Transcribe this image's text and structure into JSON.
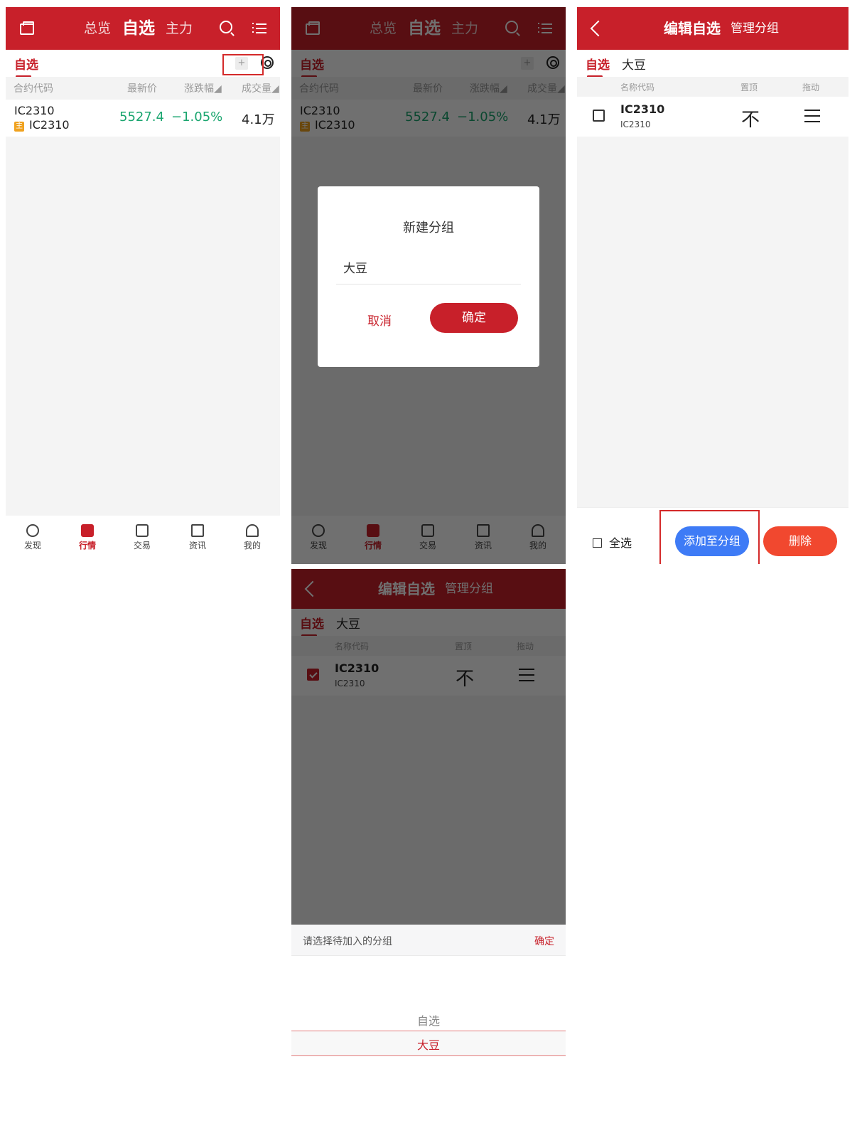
{
  "market": {
    "tabs": [
      "总览",
      "自选",
      "主力"
    ],
    "subtab": "自选",
    "plus": "+",
    "columns": [
      "合约代码",
      "最新价",
      "涨跌幅◢",
      "成交量◢"
    ],
    "row": {
      "code": "IC2310",
      "tag": "主",
      "code2": "IC2310",
      "price": "5527.4",
      "change": "−1.05%",
      "volume": "4.1万"
    },
    "nav": [
      "发现",
      "行情",
      "交易",
      "资讯",
      "我的"
    ]
  },
  "dialog": {
    "title": "新建分组",
    "input_value": "大豆",
    "cancel": "取消",
    "confirm": "确定"
  },
  "edit": {
    "title": "编辑自选",
    "manage": "管理分组",
    "groups": [
      "自选",
      "大豆"
    ],
    "columns": [
      "名称代码",
      "置顶",
      "拖动"
    ],
    "row": {
      "code": "IC2310",
      "sub": "IC2310",
      "pin_glyph": "不"
    },
    "select_all": "全选",
    "add_to_group": "添加至分组",
    "delete": "删除"
  },
  "picker": {
    "title": "请选择待加入的分组",
    "confirm": "确定",
    "options": [
      "自选",
      "大豆"
    ],
    "selected": "大豆"
  },
  "colors": {
    "brand_red": "#c8202a",
    "price_green": "#1aa56f",
    "add_blue": "#3e7bf6",
    "delete_orange": "#f1482f"
  }
}
